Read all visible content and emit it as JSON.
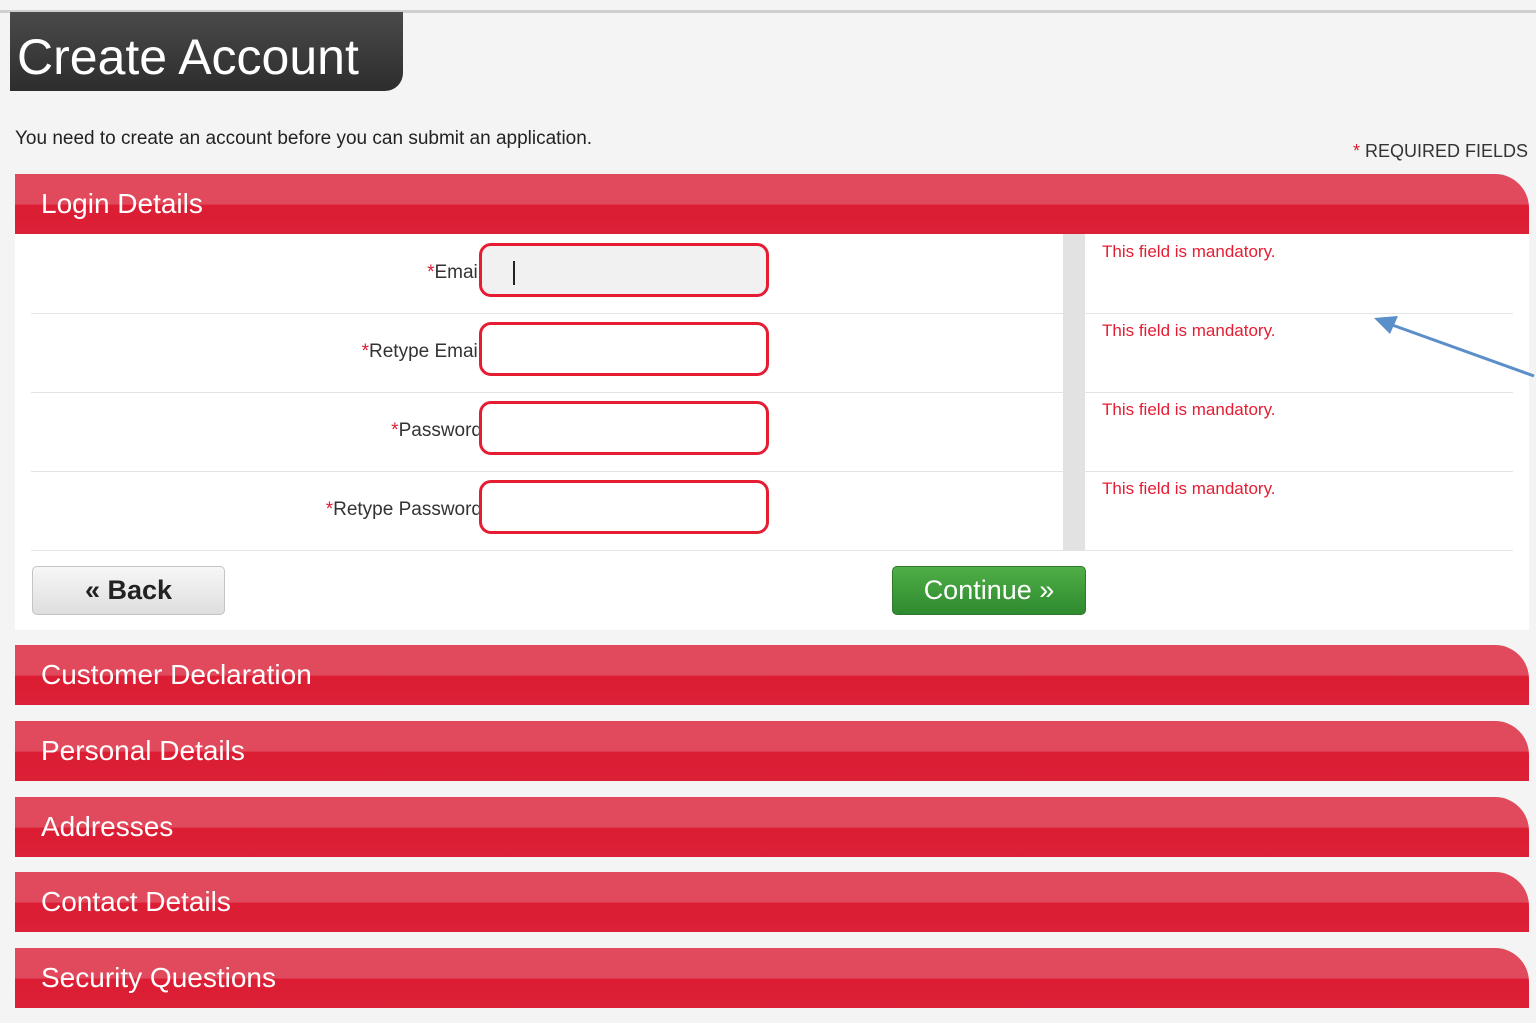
{
  "header": {
    "title": "Create Account",
    "intro": "You need to create an account before you can submit an application.",
    "required_star": "*",
    "required_note": "REQUIRED FIELDS"
  },
  "login": {
    "section_title": "Login Details",
    "fields": [
      {
        "star": "*",
        "label": "Email",
        "value": "",
        "error": "This field is mandatory."
      },
      {
        "star": "*",
        "label": "Retype Email",
        "value": "",
        "error": "This field is mandatory."
      },
      {
        "star": "*",
        "label": "Password",
        "value": "",
        "error": "This field is mandatory."
      },
      {
        "star": "*",
        "label": "Retype Password",
        "value": "",
        "error": "This field is mandatory."
      }
    ],
    "back_label": "« Back",
    "continue_label": "Continue »"
  },
  "sections": [
    "Customer Declaration",
    "Personal Details",
    "Addresses",
    "Contact Details",
    "Security Questions"
  ],
  "colors": {
    "accent_red": "#dc1d34",
    "header_dark": "#333333",
    "continue_green": "#3a9a37",
    "annotation_arrow": "#5b8fc9"
  },
  "icons": {
    "annotation": "arrow-icon"
  }
}
